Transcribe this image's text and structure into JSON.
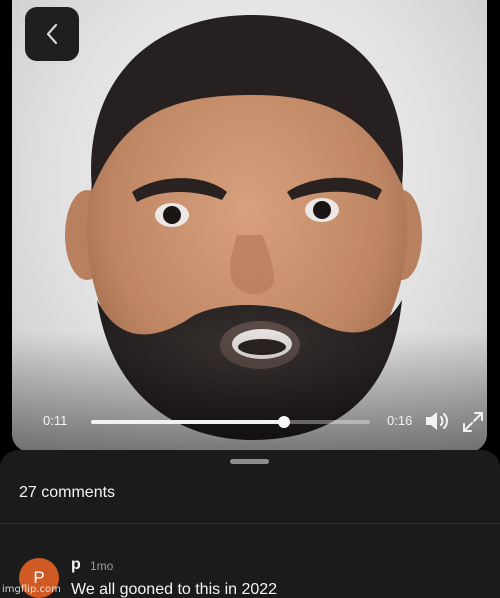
{
  "video": {
    "time_current": "0:11",
    "time_total": "0:16",
    "progress_fraction": 0.69,
    "frame_icon": "animoji-bearded-face"
  },
  "icons": {
    "back": "chevron-left-icon",
    "volume": "speaker-icon",
    "fullscreen": "expand-icon"
  },
  "comments": {
    "count_label": "27 comments",
    "items": [
      {
        "avatar_letter": "P",
        "avatar_color": "#cf5a24",
        "author": "p",
        "time": "1mo",
        "text": "We all gooned to this in 2022"
      }
    ]
  },
  "watermark": "imgflip.com",
  "colors": {
    "background": "#000000",
    "sheet": "#1b1b1c",
    "text": "#f4f4f4",
    "muted": "#9a9a9d"
  }
}
